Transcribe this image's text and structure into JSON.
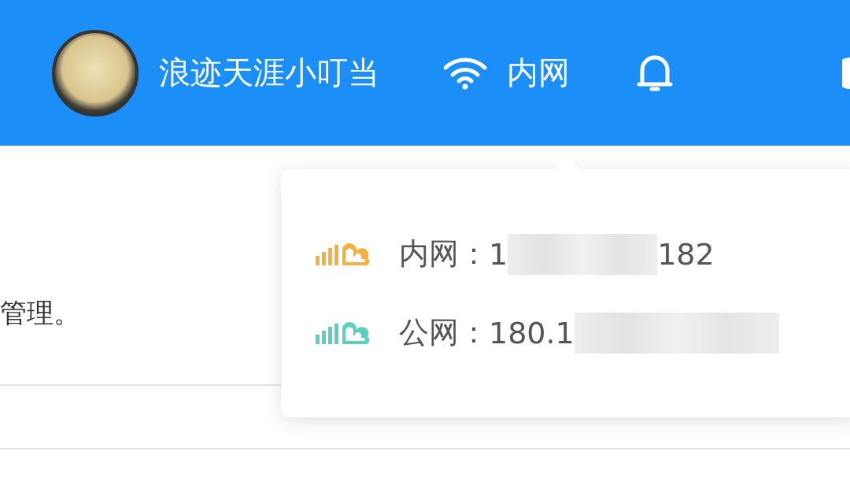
{
  "header": {
    "username": "浪迹天涯小叮当",
    "network": "内网"
  },
  "content": {
    "text": "管理。"
  },
  "popup": {
    "rows": [
      {
        "label": "内网：",
        "value_start": "1",
        "value_end": "182",
        "color": "#f6b03e"
      },
      {
        "label": "公网：",
        "value_start": "180.1",
        "value_end": "",
        "color": "#5ccfc2"
      }
    ]
  }
}
